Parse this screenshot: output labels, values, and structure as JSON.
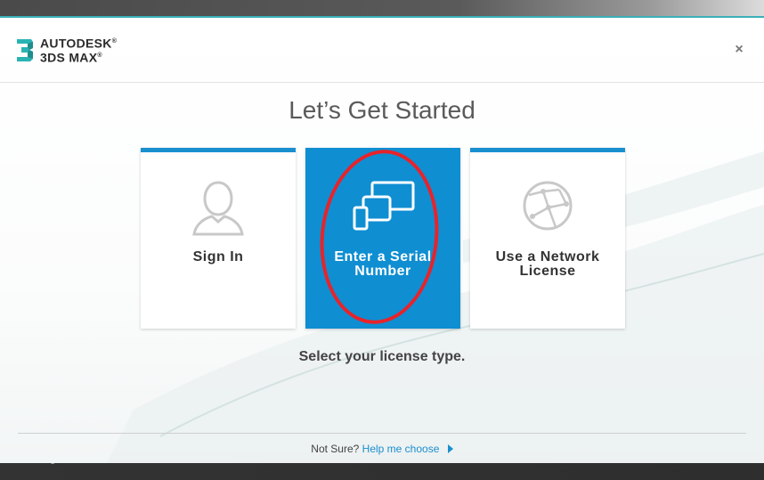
{
  "app": {
    "logo_line1": "AUTODESK",
    "logo_line2": "3DS MAX",
    "logo_trademark": "®"
  },
  "dialog": {
    "title": "Let’s Get Started",
    "close_label": "×",
    "tiles": [
      {
        "label_line1": "Sign In",
        "label_line2": "",
        "icon": "user-silhouette-icon"
      },
      {
        "label_line1": "Enter a Serial",
        "label_line2": "Number",
        "icon": "devices-icon"
      },
      {
        "label_line1": "Use a Network",
        "label_line2": "License",
        "icon": "network-globe-icon"
      }
    ],
    "subtitle": "Select your license type.",
    "footer_prefix": "Not Sure?",
    "footer_link": "Help me choose"
  },
  "background": {
    "status_text": "Initializing 3ds Max..."
  },
  "colors": {
    "accent": "#1a8fcf",
    "active_tile": "#0f8ed2",
    "highlight_ring": "#e8232a",
    "logo_teal": "#2bb3b3"
  }
}
